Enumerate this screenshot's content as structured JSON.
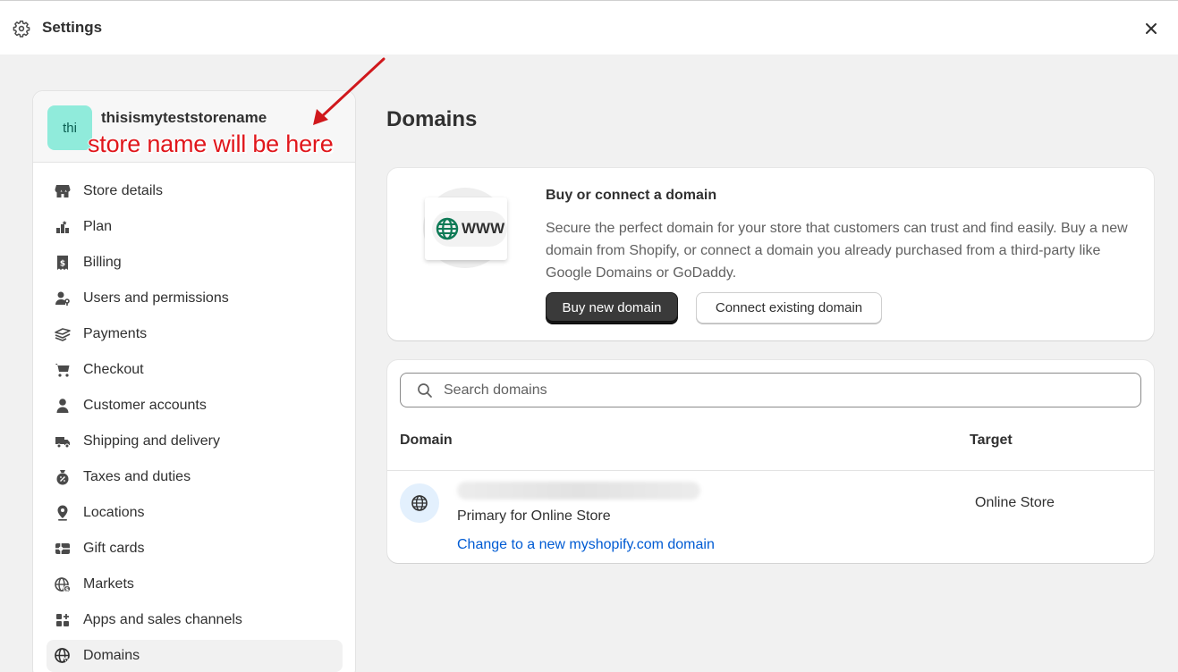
{
  "window": {
    "title": "Settings"
  },
  "store": {
    "avatar_initials": "thi",
    "name": "thisismyteststorename"
  },
  "annotation": {
    "text": "store name will be here",
    "color": "#e0161b"
  },
  "sidebar": {
    "items": [
      {
        "label": "Store details",
        "icon": "store-icon"
      },
      {
        "label": "Plan",
        "icon": "plan-icon"
      },
      {
        "label": "Billing",
        "icon": "billing-icon"
      },
      {
        "label": "Users and permissions",
        "icon": "users-icon"
      },
      {
        "label": "Payments",
        "icon": "payments-icon"
      },
      {
        "label": "Checkout",
        "icon": "cart-icon"
      },
      {
        "label": "Customer accounts",
        "icon": "person-icon"
      },
      {
        "label": "Shipping and delivery",
        "icon": "truck-icon"
      },
      {
        "label": "Taxes and duties",
        "icon": "taxes-icon"
      },
      {
        "label": "Locations",
        "icon": "location-icon"
      },
      {
        "label": "Gift cards",
        "icon": "gift-card-icon"
      },
      {
        "label": "Markets",
        "icon": "markets-icon"
      },
      {
        "label": "Apps and sales channels",
        "icon": "apps-icon"
      },
      {
        "label": "Domains",
        "icon": "domains-icon",
        "active": true
      }
    ]
  },
  "main": {
    "title": "Domains",
    "buy_card": {
      "illustration_text": "WWW",
      "title": "Buy or connect a domain",
      "description": "Secure the perfect domain for your store that customers can trust and find easily. Buy a new domain from Shopify, or connect a domain you already purchased from a third-party like Google Domains or GoDaddy.",
      "primary_button": "Buy new domain",
      "secondary_button": "Connect existing domain"
    },
    "domains_card": {
      "search_placeholder": "Search domains",
      "columns": {
        "domain": "Domain",
        "target": "Target"
      },
      "rows": [
        {
          "subtitle": "Primary for Online Store",
          "link": "Change to a new myshopify.com domain",
          "target": "Online Store"
        }
      ]
    }
  },
  "colors": {
    "accent_link": "#005bd3",
    "avatar_bg": "#90ebdb",
    "primary_button": "#303030"
  }
}
